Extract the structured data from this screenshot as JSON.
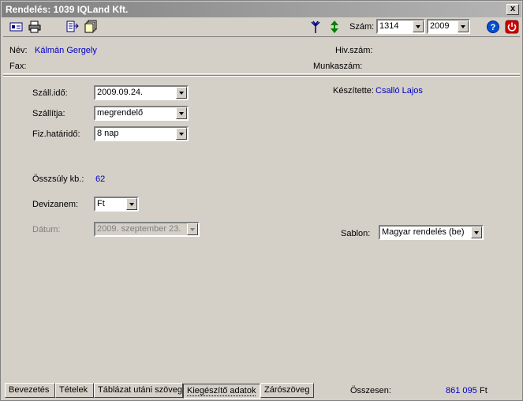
{
  "window": {
    "title": "Rendelés: 1039 IQLand Kft.",
    "close_label": "x"
  },
  "toolbar": {
    "szam_label": "Szám:",
    "number_value": "1314",
    "year_value": "2009"
  },
  "header": {
    "nev_label": "Név:",
    "nev_value": "Kálmán Gergely",
    "fax_label": "Fax:",
    "hivszam_label": "Hiv.szám:",
    "munkaszam_label": "Munkaszám:"
  },
  "form": {
    "szallido_label": "Száll.idő:",
    "szallido_value": "2009.09.24.",
    "szallitja_label": "Szállítja:",
    "szallitja_value": "megrendelő",
    "fizhatarido_label": "Fiz.határidő:",
    "fizhatarido_value": "8 nap",
    "keszitette_label": "Készítette:",
    "keszitette_value": "Csalló Lajos",
    "osszsuly_label": "Összsúly kb.:",
    "osszsuly_value": "62",
    "devizanem_label": "Devizanem:",
    "devizanem_value": "Ft",
    "datum_label": "Dátum:",
    "datum_value": "2009. szeptember 23.",
    "sablon_label": "Sablon:",
    "sablon_value": "Magyar rendelés (be)"
  },
  "tabs": [
    {
      "label": "Bevezetés"
    },
    {
      "label": "Tételek"
    },
    {
      "label": "Táblázat utáni szöveg"
    },
    {
      "label": "Kiegészítő adatok"
    },
    {
      "label": "Zárószöveg"
    }
  ],
  "footer": {
    "osszesen_label": "Összesen:",
    "osszesen_value": "861 095",
    "currency": "Ft"
  },
  "colors": {
    "value_text": "#0000c0",
    "titlebar_start": "#808080",
    "titlebar_end": "#b5b5b5"
  }
}
